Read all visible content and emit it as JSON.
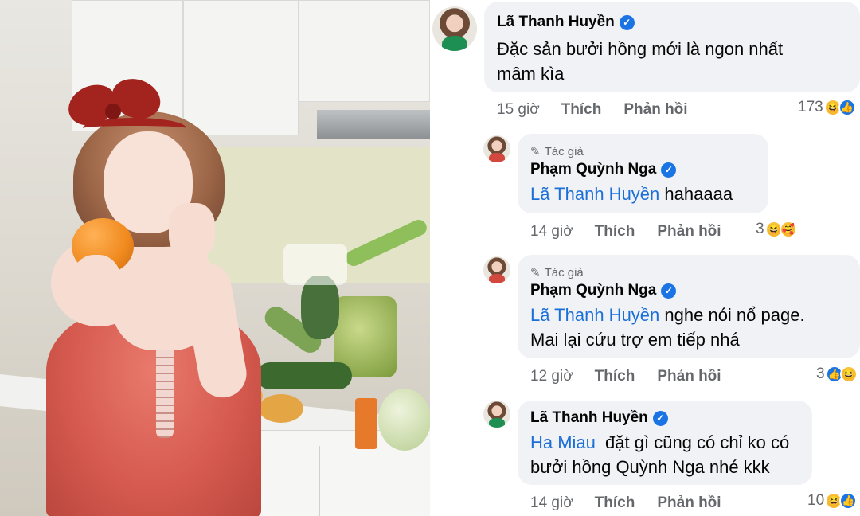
{
  "comments": [
    {
      "author": "Lã Thanh Huyền",
      "verified": true,
      "text_line1": "Đặc sản bưởi hồng mới là ngon nhất",
      "text_line2": "mâm kìa",
      "time": "15 giờ",
      "like_label": "Thích",
      "reply_label": "Phản hồi",
      "reaction_count": "173",
      "reactions": [
        "haha-icon",
        "like-icon"
      ]
    },
    {
      "author_tag": "Tác giả",
      "author": "Phạm Quỳnh Nga",
      "verified": true,
      "mention": "Lã Thanh Huyền",
      "text_line1": "hahaaaa",
      "time": "14 giờ",
      "like_label": "Thích",
      "reply_label": "Phản hồi",
      "reaction_count": "3",
      "reactions": [
        "haha-icon",
        "care-icon"
      ]
    },
    {
      "author_tag": "Tác giả",
      "author": "Phạm Quỳnh Nga",
      "verified": true,
      "mention": "Lã Thanh Huyền",
      "text_line1": "nghe nói nổ page.",
      "text_line2": "Mai lại cứu trợ em tiếp nhá",
      "time": "12 giờ",
      "like_label": "Thích",
      "reply_label": "Phản hồi",
      "reaction_count": "3",
      "reactions": [
        "like-icon",
        "haha-icon"
      ]
    },
    {
      "author": "Lã Thanh Huyền",
      "verified": true,
      "mention": "Ha Miau",
      "text_line1": "đặt gì cũng có chỉ ko có",
      "text_line2": "bưởi hồng Quỳnh Nga nhé kkk",
      "time": "14 giờ",
      "like_label": "Thích",
      "reply_label": "Phản hồi",
      "reaction_count": "10",
      "reactions": [
        "haha-icon",
        "like-icon"
      ]
    }
  ],
  "colors": {
    "bubble": "#f0f2f5",
    "mention": "#1b6fd8",
    "verified": "#1b74e4",
    "meta": "#65676b"
  }
}
